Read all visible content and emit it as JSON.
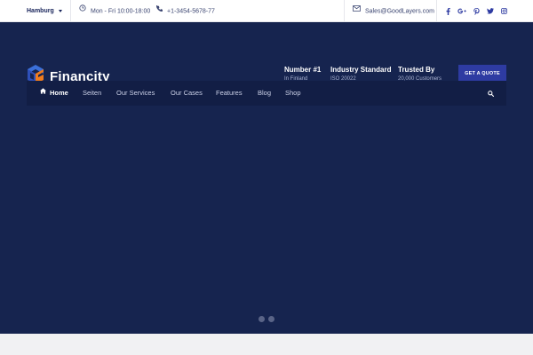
{
  "topbar": {
    "city": "Hamburg",
    "hours": "Mon - Fri 10:00-18:00",
    "phone": "+1-3454-5678-77",
    "email": "Sales@GoodLayers.com",
    "socials": [
      "facebook-icon",
      "google-plus-icon",
      "pinterest-icon",
      "twitter-icon",
      "instagram-icon"
    ]
  },
  "header": {
    "brand": "Financity",
    "info": [
      {
        "title": "Number #1",
        "sub": "In Finland"
      },
      {
        "title": "Industry Standard",
        "sub": "ISO 20022"
      },
      {
        "title": "Trusted By",
        "sub": "20,000 Customers"
      }
    ],
    "cta": "GET A QUOTE"
  },
  "nav": {
    "items": [
      "Home",
      "Seiten",
      "Our Services",
      "Our Cases",
      "Features",
      "Blog",
      "Shop"
    ],
    "active": "Home"
  },
  "slider": {
    "dots": 2
  },
  "colors": {
    "header_bg": "#16244f",
    "nav_bg": "#121e45",
    "accent": "#2e3ba2",
    "topbar_text": "#3a4470"
  }
}
